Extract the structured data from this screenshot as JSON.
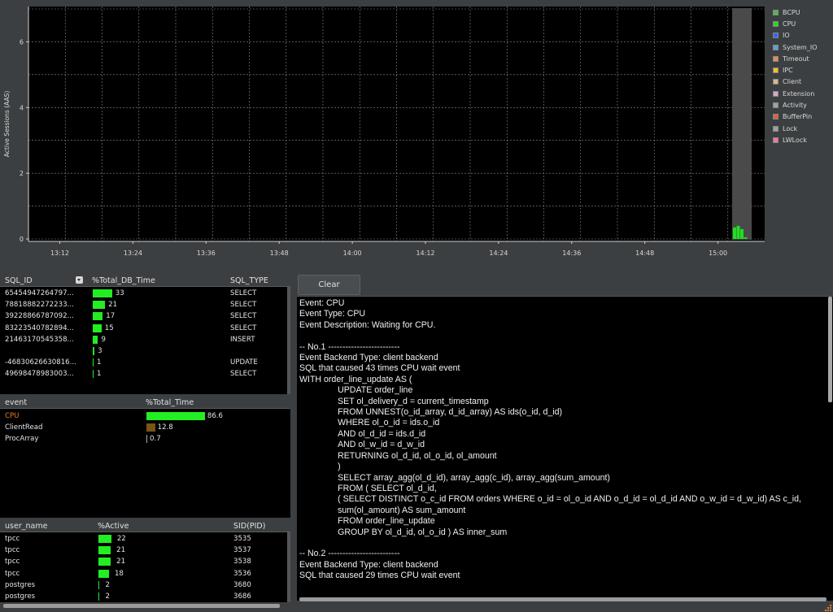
{
  "chart_data": {
    "type": "area",
    "ylabel": "Active Sessions (AAS)",
    "y_ticks": [
      "0",
      "2",
      "4",
      "6"
    ],
    "ylim": [
      0,
      7
    ],
    "x_ticks": [
      "13:12",
      "13:24",
      "13:36",
      "13:48",
      "14:00",
      "14:12",
      "14:24",
      "14:36",
      "14:48",
      "15:00"
    ],
    "grid": true,
    "legend_position": "right",
    "series": [
      {
        "name": "BCPU",
        "color": "#4cbb4c"
      },
      {
        "name": "CPU",
        "color": "#22dd22"
      },
      {
        "name": "IO",
        "color": "#3366ff"
      },
      {
        "name": "System_IO",
        "color": "#5ea0d8"
      },
      {
        "name": "Timeout",
        "color": "#e8895a"
      },
      {
        "name": "IPC",
        "color": "#f0c419"
      },
      {
        "name": "Client",
        "color": "#d4b98a"
      },
      {
        "name": "Extension",
        "color": "#d7a7c7"
      },
      {
        "name": "Activity",
        "color": "#9aa69a"
      },
      {
        "name": "BufferPin",
        "color": "#e06040"
      },
      {
        "name": "Lock",
        "color": "#a0a0a0"
      },
      {
        "name": "LWLock",
        "color": "#e87aa0"
      }
    ],
    "recent_cpu_values": [
      0.35,
      0.4,
      0.3,
      0.05
    ]
  },
  "sql_table": {
    "headers": {
      "sql_id": "SQL_ID",
      "pct": "%Total_DB_Time",
      "type": "SQL_TYPE"
    },
    "rows": [
      {
        "id": "65454947264797...",
        "value": "33",
        "pct": 33,
        "type": "SELECT"
      },
      {
        "id": "78818882272233...",
        "value": "21",
        "pct": 21,
        "type": "SELECT"
      },
      {
        "id": "39228866787092...",
        "value": "17",
        "pct": 17,
        "type": "SELECT"
      },
      {
        "id": "83223540782894...",
        "value": "15",
        "pct": 15,
        "type": "SELECT"
      },
      {
        "id": "21463170545358...",
        "value": "9",
        "pct": 9,
        "type": "INSERT"
      },
      {
        "id": "",
        "value": "3",
        "pct": 3,
        "type": ""
      },
      {
        "id": "-46830626630816...",
        "value": "1",
        "pct": 1,
        "type": "UPDATE"
      },
      {
        "id": "49698478983003...",
        "value": "1",
        "pct": 1,
        "type": "SELECT"
      }
    ]
  },
  "event_table": {
    "headers": {
      "event": "event",
      "pct": "%Total_Time"
    },
    "rows": [
      {
        "event": "CPU",
        "value": "86.6",
        "pct": 86.6,
        "color": "#22ee22",
        "text_color": "#e87d2a"
      },
      {
        "event": "ClientRead",
        "value": "12.8",
        "pct": 12.8,
        "color": "#7a5416",
        "text_color": "#e4e4e4"
      },
      {
        "event": "ProcArray",
        "value": "0.7",
        "pct": 0.7,
        "color": "#aaaaaa",
        "text_color": "#e4e4e4"
      }
    ]
  },
  "user_table": {
    "headers": {
      "user": "user_name",
      "pct": "%Active",
      "sid": "SID(PID)"
    },
    "rows": [
      {
        "user": "tpcc",
        "value": "22",
        "pct": 22,
        "sid": "3535"
      },
      {
        "user": "tpcc",
        "value": "21",
        "pct": 21,
        "sid": "3537"
      },
      {
        "user": "tpcc",
        "value": "21",
        "pct": 21,
        "sid": "3538"
      },
      {
        "user": "tpcc",
        "value": "18",
        "pct": 18,
        "sid": "3536"
      },
      {
        "user": "postgres",
        "value": "2",
        "pct": 2,
        "sid": "3680"
      },
      {
        "user": "postgres",
        "value": "2",
        "pct": 2,
        "sid": "3686"
      }
    ]
  },
  "clear_label": "Clear",
  "detail_text": "Event: CPU\nEvent Type: CPU\nEvent Description: Waiting for CPU.\n\n-- No.1 -------------------------\nEvent Backend Type: client backend\nSQL that caused 43 times CPU wait event\nWITH order_line_update AS (\n\t\tUPDATE order_line\n\t\tSET ol_delivery_d = current_timestamp\n\t\tFROM UNNEST(o_id_array, d_id_array) AS ids(o_id, d_id)\n\t\tWHERE ol_o_id = ids.o_id\n\t\tAND ol_d_id = ids.d_id\n\t\tAND ol_w_id = d_w_id\n\t\tRETURNING ol_d_id, ol_o_id, ol_amount\n\t\t)\n\t\tSELECT array_agg(ol_d_id), array_agg(c_id), array_agg(sum_amount)\n\t\tFROM ( SELECT ol_d_id,\n\t\t( SELECT DISTINCT o_c_id FROM orders WHERE o_id = ol_o_id AND o_d_id = ol_d_id AND o_w_id = d_w_id) AS c_id,\n\t\tsum(ol_amount) AS sum_amount\n\t\tFROM order_line_update\n\t\tGROUP BY ol_d_id, ol_o_id ) AS inner_sum\n\n-- No.2 -------------------------\nEvent Backend Type: client backend\nSQL that caused 29 times CPU wait event"
}
